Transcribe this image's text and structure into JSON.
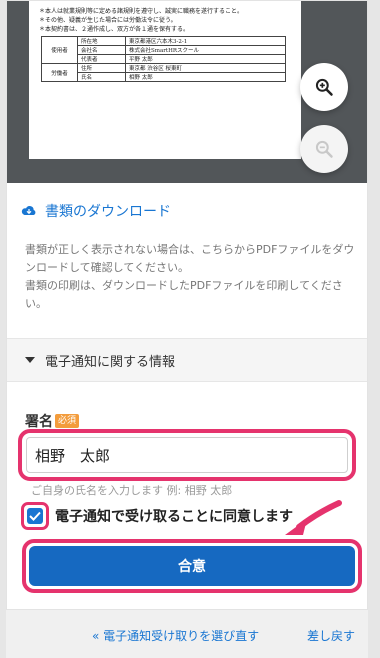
{
  "document": {
    "notes": [
      "＊本人は就業規則等に定める諸規則を遵守し、誠実に職務を遂行すること。",
      "＊その他、疑義が生じた場合には労働法令に従う。",
      "＊本契約書は、２通作成し、双方が各１通を保有する。"
    ],
    "table": {
      "employer_label": "使用者",
      "worker_label": "労働者",
      "rows": [
        {
          "field": "所在地",
          "value": "東京都港区六本木3-2-1"
        },
        {
          "field": "会社名",
          "value": "株式会社SmartHRスクール"
        },
        {
          "field": "代表者",
          "value": "平野 太郎"
        },
        {
          "field": "住所",
          "value": "東京都 渋谷区 桜東町"
        },
        {
          "field": "氏名",
          "value": "相野 太郎"
        }
      ]
    }
  },
  "viewer": {
    "zoom_in_icon": "zoom-in-icon",
    "zoom_out_icon": "zoom-out-icon"
  },
  "download": {
    "icon": "cloud-download-icon",
    "label": "書類のダウンロード"
  },
  "help_text": {
    "line1": "書類が正しく表示されない場合は、こちらからPDFファイルをダウンロードして確認してください。",
    "line2": "書類の印刷は、ダウンロードしたPDFファイルを印刷してください。"
  },
  "accordion": {
    "title": "電子通知に関する情報"
  },
  "signature": {
    "label": "署名",
    "required_badge": "必須",
    "value": "相野　太郎",
    "hint": "ご自身の氏名を入力します 例: 相野 太郎"
  },
  "consent": {
    "checked": true,
    "label": "電子通知で受け取ることに同意します"
  },
  "agree_button": {
    "label": "合意"
  },
  "footer_links": {
    "reselect": "« 電子通知受け取りを選び直す",
    "return": "差し戻す"
  },
  "colors": {
    "accent_blue": "#1976d2",
    "button_blue": "#1669c1",
    "highlight_pink": "#e5336d",
    "badge_orange": "#f39c3c"
  }
}
